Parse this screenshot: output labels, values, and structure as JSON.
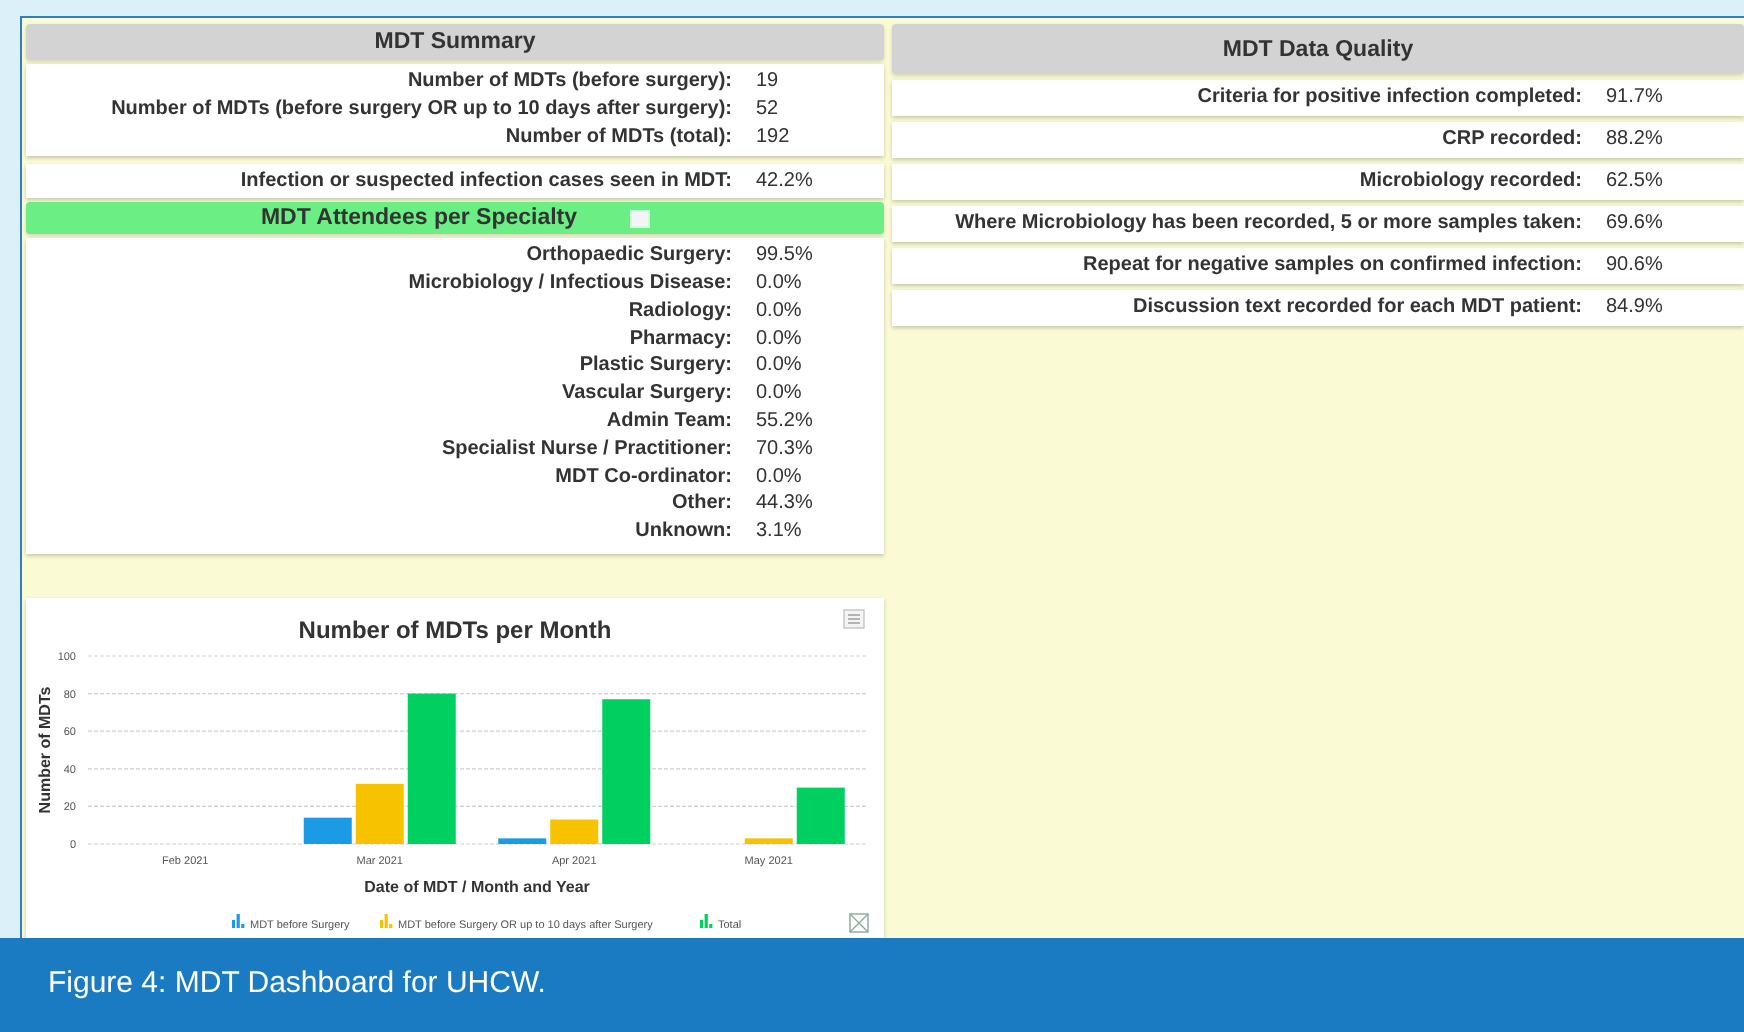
{
  "summary": {
    "title": "MDT Summary",
    "rows": [
      {
        "label": "Number of MDTs (before surgery):",
        "value": "19"
      },
      {
        "label": "Number of MDTs (before surgery OR up to 10 days after surgery):",
        "value": "52"
      },
      {
        "label": "Number of MDTs (total):",
        "value": "192"
      }
    ],
    "infection": {
      "label": "Infection or suspected infection cases seen in MDT:",
      "value": "42.2%"
    }
  },
  "attendees": {
    "title": "MDT Attendees per Specialty",
    "rows": [
      {
        "label": "Orthopaedic Surgery:",
        "value": "99.5%"
      },
      {
        "label": "Microbiology / Infectious Disease:",
        "value": "0.0%"
      },
      {
        "label": "Radiology:",
        "value": "0.0%"
      },
      {
        "label": "Pharmacy:",
        "value": "0.0%"
      },
      {
        "label": "Plastic Surgery:",
        "value": "0.0%"
      },
      {
        "label": "Vascular Surgery:",
        "value": "0.0%"
      },
      {
        "label": "Admin Team:",
        "value": "55.2%"
      },
      {
        "label": "Specialist Nurse / Practitioner:",
        "value": "70.3%"
      },
      {
        "label": "MDT Co-ordinator:",
        "value": "0.0%"
      },
      {
        "label": "Other:",
        "value": "44.3%"
      },
      {
        "label": "Unknown:",
        "value": "3.1%"
      }
    ]
  },
  "data_quality": {
    "title": "MDT Data Quality",
    "rows": [
      {
        "label": "Criteria for positive infection completed:",
        "value": "91.7%"
      },
      {
        "label": "CRP recorded:",
        "value": "88.2%"
      },
      {
        "label": "Microbiology recorded:",
        "value": "62.5%"
      },
      {
        "label": "Where Microbiology has been recorded, 5 or more samples taken:",
        "value": "69.6%"
      },
      {
        "label": "Repeat for negative samples on confirmed infection:",
        "value": "90.6%"
      },
      {
        "label": "Discussion text recorded for each MDT patient:",
        "value": "84.9%"
      }
    ]
  },
  "chart": {
    "chart_data": {
      "type": "bar",
      "title": "Number of MDTs per Month",
      "xlabel": "Date of MDT / Month and Year",
      "ylabel": "Number of MDTs",
      "categories": [
        "Feb 2021",
        "Mar 2021",
        "Apr 2021",
        "May 2021"
      ],
      "series": [
        {
          "name": "MDT before Surgery",
          "color": "#1a9be3",
          "values": [
            0,
            14,
            3,
            0
          ]
        },
        {
          "name": "MDT before Surgery OR up to 10 days after Surgery",
          "color": "#f7c200",
          "values": [
            0,
            32,
            13,
            3
          ]
        },
        {
          "name": "Total",
          "color": "#00d060",
          "values": [
            0,
            80,
            77,
            30
          ]
        }
      ],
      "ylim": [
        0,
        100
      ],
      "yticks": [
        0,
        20,
        40,
        60,
        80,
        100
      ],
      "grid": true,
      "legend": true
    }
  },
  "caption": "Figure 4: MDT Dashboard for UHCW."
}
